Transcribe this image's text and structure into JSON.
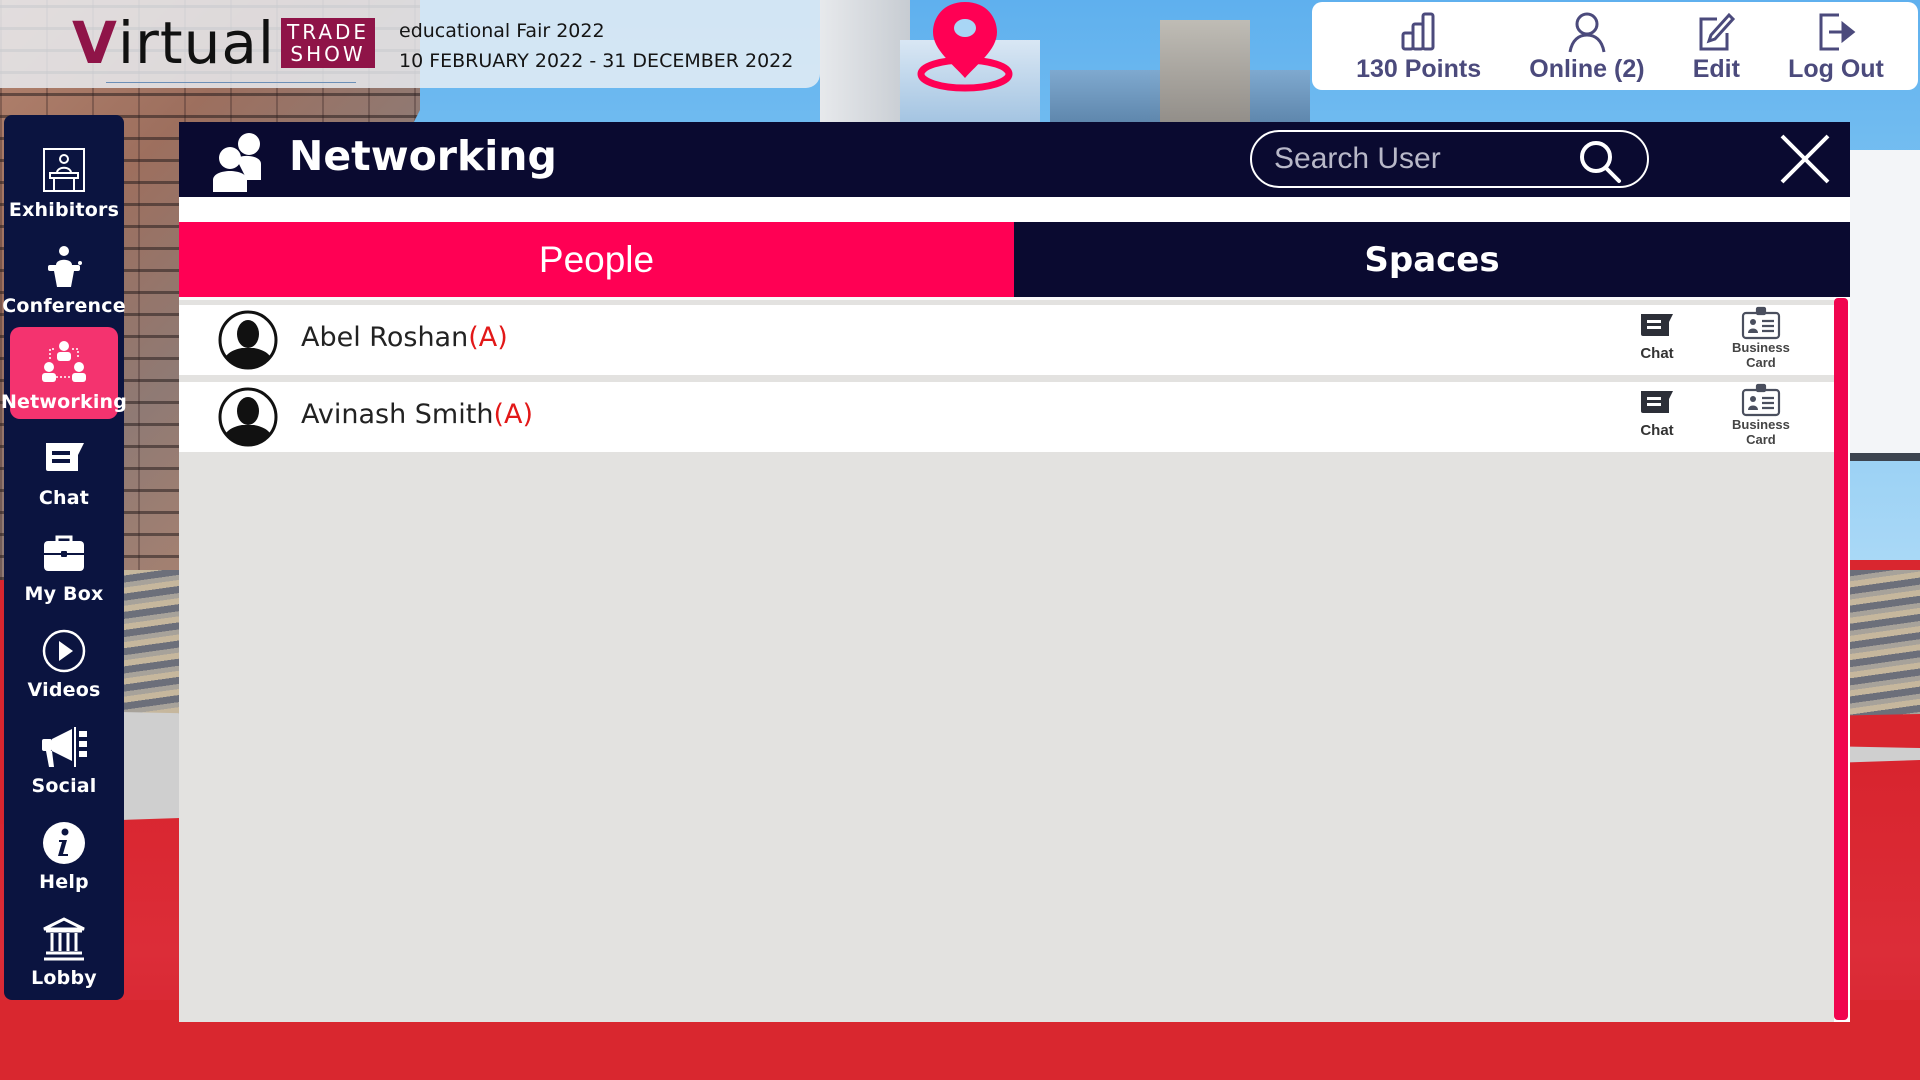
{
  "event": {
    "logo_text": "Virtual",
    "logo_box_line1": "TRADE",
    "logo_box_line2": "SHOW",
    "name": "educational Fair 2022",
    "dates": "10 FEBRUARY 2022 - 31 DECEMBER 2022"
  },
  "topbar": {
    "items": [
      {
        "label": "130 Points",
        "icon": "bar-chart-icon"
      },
      {
        "label": "Online (2)",
        "icon": "user-icon"
      },
      {
        "label": "Edit",
        "icon": "edit-icon"
      },
      {
        "label": "Log Out",
        "icon": "logout-icon"
      }
    ]
  },
  "sidebar": {
    "items": [
      {
        "label": "Exhibitors",
        "icon": "exhibitor-booth-icon",
        "active": false
      },
      {
        "label": "Conference",
        "icon": "podium-icon",
        "active": false
      },
      {
        "label": "Networking",
        "icon": "networking-icon",
        "active": true
      },
      {
        "label": "Chat",
        "icon": "chat-icon",
        "active": false
      },
      {
        "label": "My Box",
        "icon": "briefcase-icon",
        "active": false
      },
      {
        "label": "Videos",
        "icon": "play-icon",
        "active": false
      },
      {
        "label": "Social",
        "icon": "megaphone-icon",
        "active": false
      },
      {
        "label": "Help",
        "icon": "info-icon",
        "active": false
      },
      {
        "label": "Lobby",
        "icon": "building-icon",
        "active": false
      }
    ]
  },
  "panel": {
    "title": "Networking",
    "search_placeholder": "Search User",
    "search_value": "",
    "tabs": [
      {
        "label": "People",
        "active": true
      },
      {
        "label": "Spaces",
        "active": false
      }
    ],
    "people": [
      {
        "name": "Abel Roshan",
        "badge": "(A)",
        "chat_label": "Chat",
        "card_label_1": "Business",
        "card_label_2": "Card"
      },
      {
        "name": "Avinash Smith",
        "badge": "(A)",
        "chat_label": "Chat",
        "card_label_1": "Business",
        "card_label_2": "Card"
      }
    ]
  },
  "colors": {
    "accent": "#ff0054",
    "navy": "#0a0a30",
    "sidebar": "#0b1440",
    "sidebar_active": "#f4336f",
    "topbar_text": "#4b4a7c",
    "badge": "#e21818",
    "logo": "#8f1448"
  }
}
